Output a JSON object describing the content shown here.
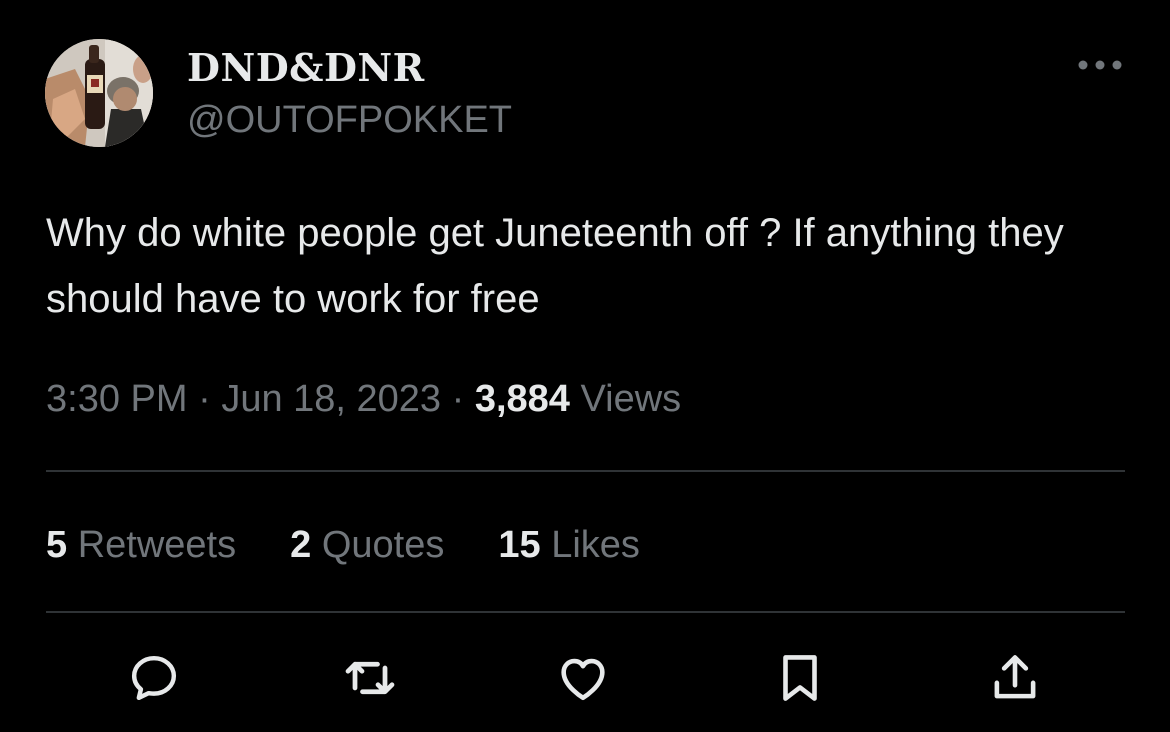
{
  "author": {
    "display_name": "DND&DNR",
    "handle": "@OUTOFPOKKET"
  },
  "tweet": {
    "text": "Why do white people get Juneteenth off ? If anything they should have to work for free",
    "time": "3:30 PM",
    "date": "Jun 18, 2023",
    "views_count": "3,884",
    "views_label": "Views"
  },
  "stats": {
    "retweets_count": "5",
    "retweets_label": "Retweets",
    "quotes_count": "2",
    "quotes_label": "Quotes",
    "likes_count": "15",
    "likes_label": "Likes"
  },
  "icons": {
    "more": "more-horizontal-icon",
    "reply": "reply-icon",
    "retweet": "retweet-icon",
    "like": "heart-icon",
    "bookmark": "bookmark-icon",
    "share": "share-icon"
  },
  "colors": {
    "background": "#000000",
    "primary_text": "#e7e9ea",
    "secondary_text": "#71767b",
    "divider": "#2f3336"
  }
}
